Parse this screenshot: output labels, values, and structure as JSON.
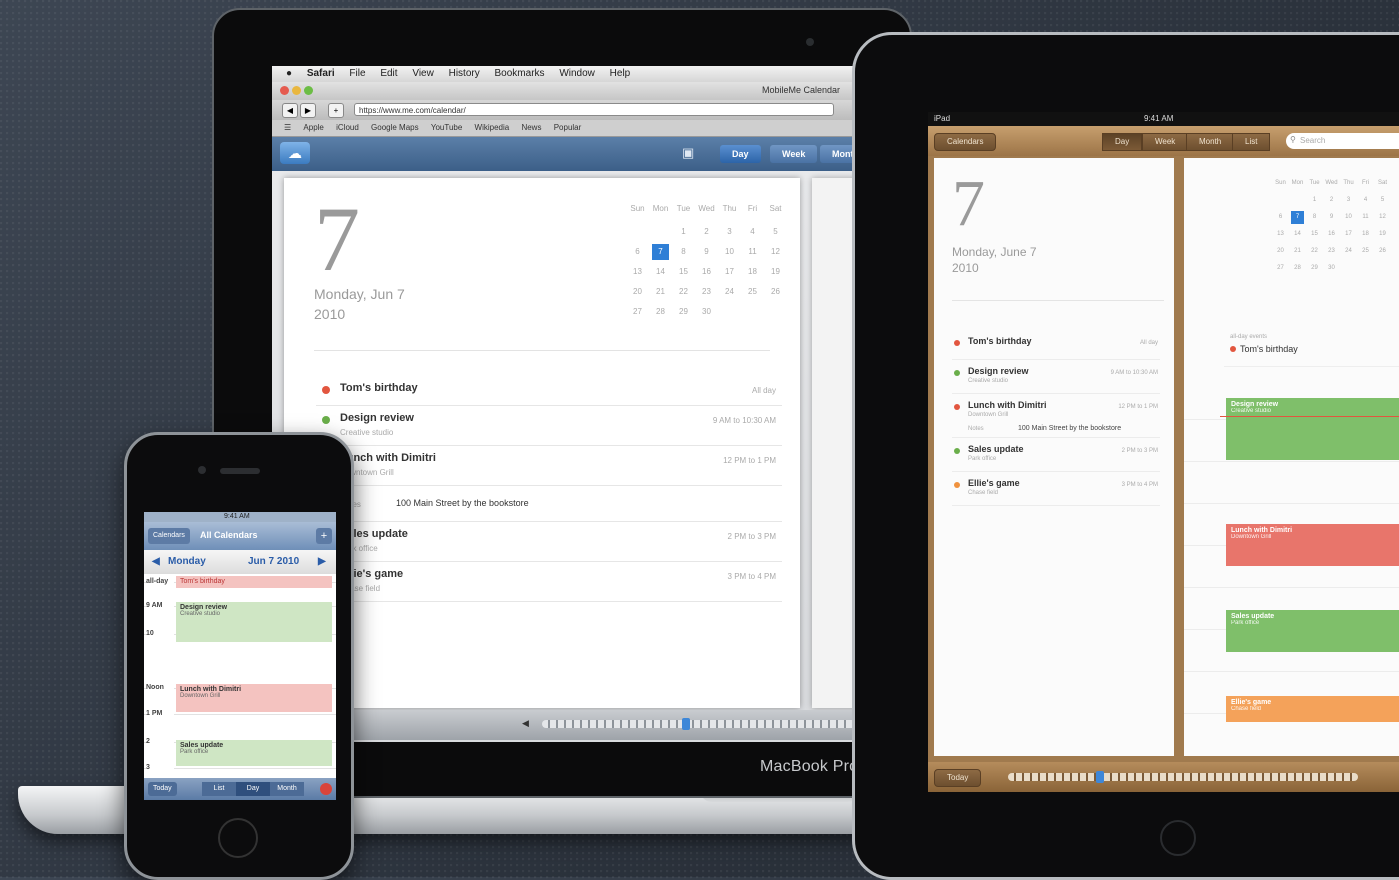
{
  "laptop": {
    "brand_label": "MacBook Pro",
    "menu": [
      "Safari",
      "File",
      "Edit",
      "View",
      "History",
      "Bookmarks",
      "Window",
      "Help"
    ],
    "window_title": "MobileMe Calendar",
    "url": "https://www.me.com/calendar/",
    "bookmarks": [
      "Apple",
      "iCloud",
      "Google Maps",
      "YouTube",
      "Wikipedia",
      "News",
      "Popular"
    ],
    "toolbar": {
      "day": "Day",
      "week": "Week",
      "month": "Month"
    },
    "day_number": "7",
    "date_line1": "Monday, Jun 7",
    "date_line2": "2010",
    "mini_cal_headers": [
      "Sun",
      "Mon",
      "Tue",
      "Wed",
      "Thu",
      "Fri",
      "Sat"
    ],
    "mini_cal_rows": [
      [
        "",
        "",
        "1",
        "2",
        "3",
        "4",
        "5"
      ],
      [
        "6",
        "7",
        "8",
        "9",
        "10",
        "11",
        "12"
      ],
      [
        "13",
        "14",
        "15",
        "16",
        "17",
        "18",
        "19"
      ],
      [
        "20",
        "21",
        "22",
        "23",
        "24",
        "25",
        "26"
      ],
      [
        "27",
        "28",
        "29",
        "30",
        "",
        "",
        ""
      ]
    ],
    "events": [
      {
        "title": "Tom's birthday",
        "sub": "",
        "time": "All day",
        "color": "#e2563f"
      },
      {
        "title": "Design review",
        "sub": "Creative studio",
        "time": "9 AM to 10:30 AM",
        "color": "#6aae4a"
      },
      {
        "title": "Lunch with Dimitri",
        "sub": "Downtown Grill",
        "time": "12 PM to 1 PM",
        "color": "#e2563f"
      },
      {
        "title": "",
        "sub": "",
        "time": "",
        "color": ""
      },
      {
        "title": "Sales update",
        "sub": "Park office",
        "time": "2 PM to 3 PM",
        "color": "#6aae4a"
      },
      {
        "title": "Ellie's game",
        "sub": "Chase field",
        "time": "3 PM to 4 PM",
        "color": "#f0923e"
      }
    ],
    "location_label": "Notes",
    "location_value": "100 Main Street by the bookstore"
  },
  "ipad": {
    "status_left": "iPad",
    "status_time": "9:41 AM",
    "calendars_btn": "Calendars",
    "segments": [
      "Day",
      "Week",
      "Month",
      "List"
    ],
    "search_placeholder": "Search",
    "day_number": "7",
    "date_line1": "Monday, June 7",
    "date_line2": "2010",
    "events": [
      {
        "title": "Tom's birthday",
        "sub": "",
        "time": "All day",
        "color": "#e2563f"
      },
      {
        "title": "Design review",
        "sub": "Creative studio",
        "time": "9 AM to 10:30 AM",
        "color": "#6aae4a"
      },
      {
        "title": "Lunch with Dimitri",
        "sub": "Downtown Grill",
        "time": "12 PM to 1 PM",
        "color": "#e2563f"
      },
      {
        "title": "Sales update",
        "sub": "Park office",
        "time": "2 PM to 3 PM",
        "color": "#6aae4a"
      },
      {
        "title": "Ellie's game",
        "sub": "Chase field",
        "time": "3 PM to 4 PM",
        "color": "#f0923e"
      }
    ],
    "notes_label": "Notes",
    "notes_value": "100 Main Street by the bookstore",
    "allday_label": "all-day events",
    "allday_event": "Tom's birthday",
    "timeline_blocks": [
      {
        "title": "Design review",
        "sub": "Creative studio",
        "color": "#7fbf6a"
      },
      {
        "title": "Lunch with Dimitri",
        "sub": "Downtown Grill",
        "color": "#e8756b"
      },
      {
        "title": "Sales update",
        "sub": "Park office",
        "color": "#7fbf6a"
      },
      {
        "title": "Ellie's game",
        "sub": "Chase field",
        "color": "#f4a25a"
      }
    ],
    "today_btn": "Today"
  },
  "iphone": {
    "status_time": "9:41 AM",
    "nav_left": "Calendars",
    "nav_title": "All Calendars",
    "date_day": "Monday",
    "date_full": "Jun 7 2010",
    "allday": "Tom's birthday",
    "hours": [
      "all-day",
      "9 AM",
      "10",
      "Noon",
      "1 PM",
      "2",
      "3"
    ],
    "blocks": [
      {
        "title": "Design review",
        "sub": "Creative studio",
        "color": "#cfe6c4"
      },
      {
        "title": "Lunch with Dimitri",
        "sub": "Downtown Grill",
        "color": "#f4c3c0"
      },
      {
        "title": "Sales update",
        "sub": "Park office",
        "color": "#cfe6c4"
      }
    ],
    "bottom_today": "Today",
    "bottom_segments": [
      "List",
      "Day",
      "Month"
    ]
  }
}
